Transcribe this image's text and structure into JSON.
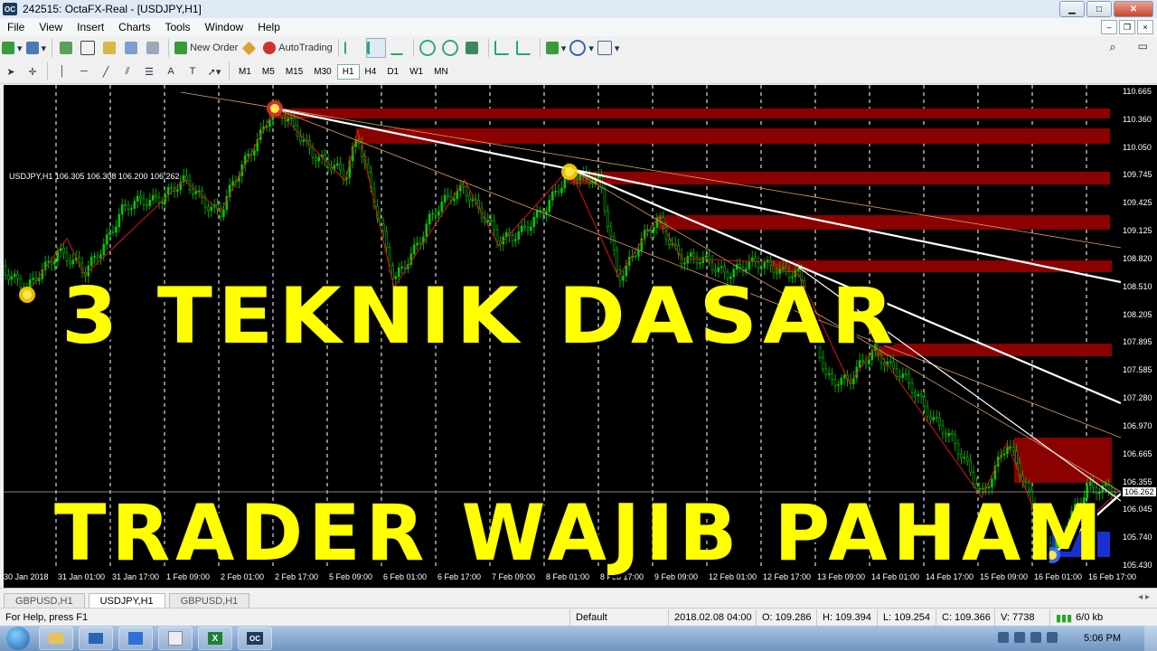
{
  "window": {
    "title": "242515: OctaFX-Real - [USDJPY,H1]",
    "app_icon": "OC"
  },
  "menu": [
    "File",
    "View",
    "Insert",
    "Charts",
    "Tools",
    "Window",
    "Help"
  ],
  "toolbar": {
    "new_order": "New Order",
    "autotrading": "AutoTrading",
    "timeframes": [
      "M1",
      "M5",
      "M15",
      "M30",
      "H1",
      "H4",
      "D1",
      "W1",
      "MN"
    ],
    "active_timeframe": "H1"
  },
  "chart": {
    "symbol_info": "USDJPY,H1  106.305 106.308 106.200 106.262",
    "price_labels": [
      "110.665",
      "110.360",
      "110.050",
      "109.745",
      "109.425",
      "109.125",
      "108.820",
      "108.510",
      "108.205",
      "107.895",
      "107.585",
      "107.280",
      "106.970",
      "106.665",
      "106.355",
      "106.262",
      "106.045",
      "105.740",
      "105.430"
    ],
    "current_price": "106.262",
    "time_labels": [
      "30 Jan 2018",
      "31 Jan 01:00",
      "31 Jan 17:00",
      "1 Feb 09:00",
      "2 Feb 01:00",
      "2 Feb 17:00",
      "5 Feb 09:00",
      "6 Feb 01:00",
      "6 Feb 17:00",
      "7 Feb 09:00",
      "8 Feb 01:00",
      "8 Feb 17:00",
      "9 Feb 09:00",
      "12 Feb 01:00",
      "12 Feb 17:00",
      "13 Feb 09:00",
      "14 Feb 01:00",
      "14 Feb 17:00",
      "15 Feb 09:00",
      "16 Feb 01:00",
      "16 Feb 17:00"
    ],
    "colors": {
      "bull": "#00c800",
      "zone_red": "#8b0000",
      "zone_blue": "#1a2fd0",
      "overlay": "#ffff00"
    }
  },
  "overlay": {
    "line1": "3 TEKNIK DASAR",
    "line2": "TRADER WAJIB PAHAM"
  },
  "tabs": [
    "GBPUSD,H1",
    "USDJPY,H1",
    "GBPUSD,H1"
  ],
  "active_tab": 1,
  "status": {
    "help": "For Help, press F1",
    "profile": "Default",
    "datetime": "2018.02.08 04:00",
    "open": "O: 109.286",
    "high": "H: 109.394",
    "low": "L: 109.254",
    "close": "C: 109.366",
    "volume": "V: 7738",
    "traffic": "6/0 kb"
  },
  "taskbar": {
    "clock": "5:06 PM"
  }
}
